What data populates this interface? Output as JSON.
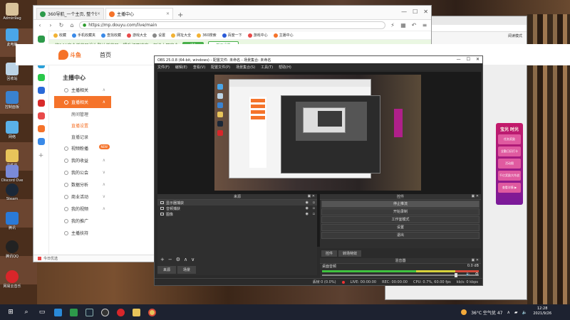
{
  "desktop": {
    "icons": [
      {
        "label": "Admin9ag"
      },
      {
        "label": "此电脑"
      },
      {
        "label": "回收站"
      },
      {
        "label": "控制面板"
      },
      {
        "label": "网络"
      },
      {
        "label": "文件夹"
      },
      {
        "label": "文件夹"
      },
      {
        "label": "Discord Overlay"
      },
      {
        "label": "Steam"
      },
      {
        "label": "腾讯"
      },
      {
        "label": "腾讯QQ"
      },
      {
        "label": "网易云音乐"
      },
      {
        "label": "网易云音乐 一键"
      }
    ],
    "bg_window": {
      "read_mode": "阅读模式",
      "promo_title": "宝光 时光",
      "promo_items": [
        "任务奖励",
        "全勤日历打卡",
        "活动图",
        "千亿奖励大作战",
        "查看详情 ▶"
      ]
    }
  },
  "browser": {
    "tabs": [
      {
        "label": "360导航_一个主页, 整个世界",
        "icon_color": "#2d9a4a"
      },
      {
        "label": "主播中心",
        "icon_color": "#f5732a"
      }
    ],
    "url": "https://mp.douyu.com/live/main",
    "bookmarks": [
      "收藏",
      "手机收藏夹",
      "查找收藏",
      "游戏大全",
      "设置",
      "网址大全",
      "360搜索",
      "百度一下",
      "游戏中心",
      "主播中心"
    ],
    "safe_bar": {
      "text": "将360安全浏览器设为默认浏览器，提升打开速度，保护上网安全",
      "btn_yes": "设为",
      "btn_no": "暂不设置"
    },
    "statusbar": "今日优选",
    "douyu": {
      "logo_text": "斗鱼",
      "home": "首页",
      "sidebar_title": "主播中心",
      "items": [
        {
          "label": "主播相关",
          "arrow": "∧"
        },
        {
          "label": "直播相关",
          "arrow": "∧",
          "active": true
        },
        {
          "label": "视频粉播",
          "arrow": ""
        },
        {
          "label": "我的收益",
          "arrow": "∧"
        },
        {
          "label": "我的公会",
          "arrow": "∨"
        },
        {
          "label": "数据分析",
          "arrow": "∧"
        },
        {
          "label": "商业活动",
          "arrow": "∨"
        },
        {
          "label": "我的视频",
          "arrow": "∧"
        },
        {
          "label": "我的推广",
          "arrow": ""
        },
        {
          "label": "主播扶持",
          "arrow": ""
        }
      ],
      "subitems": [
        "房间管理",
        "直播设置",
        "直播记录"
      ],
      "new_badge": "NEW"
    }
  },
  "obs": {
    "title": "OBS 25.0.8 (64-bit, windows) - 配置文件: 未命名 - 场景集合: 未命名",
    "menu": [
      "文件(F)",
      "编辑(E)",
      "查看(V)",
      "配置文件(P)",
      "场景集合(S)",
      "工具(T)",
      "帮助(H)"
    ],
    "sources_head": "来源",
    "sources": [
      "显示器捕获",
      "音频捕获",
      "图像"
    ],
    "source_tabs": [
      "来源",
      "场景"
    ],
    "controls_head": "控件",
    "controls": [
      "停止推流",
      "开始录制",
      "工作室模式",
      "设置",
      "退出"
    ],
    "control_tabs": [
      "控件",
      "转场特效"
    ],
    "mixer_head": "混音器",
    "mixer_track": "桌面音频",
    "mixer_db": "0.0 dB",
    "status": {
      "dropped": "丢帧 0 (0.0%)",
      "live": "LIVE: 00:00:00",
      "rec": "REC: 00:00:00",
      "cpu": "CPU: 0.7%, 60.00 fps",
      "kbps": "kb/s: 0 kbps"
    }
  },
  "taskbar": {
    "weather": "36°C 空气优 47",
    "time": "12:28",
    "date": "2021/9/26"
  }
}
